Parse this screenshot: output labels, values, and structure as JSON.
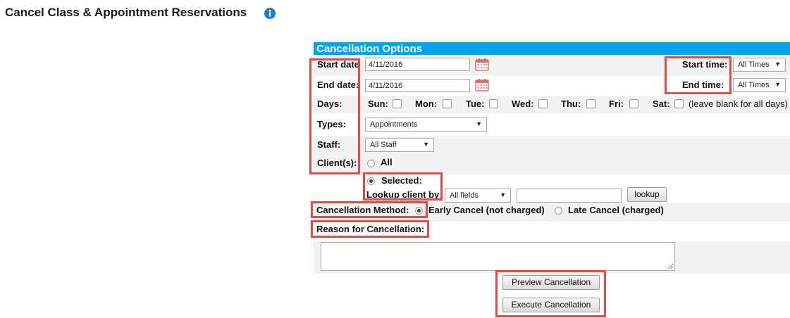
{
  "page": {
    "title": "Cancel Class & Appointment Reservations"
  },
  "panel": {
    "header": "Cancellation Options"
  },
  "labels": {
    "start_date": "Start date",
    "end_date": "End date:",
    "days": "Days:",
    "types": "Types:",
    "staff": "Staff:",
    "clients": "Client(s):",
    "start_time": "Start time:",
    "end_time": "End time:",
    "cancellation_method": "Cancellation Method:",
    "reason": "Reason for Cancellation:",
    "lookup_client_by": "Lookup client by"
  },
  "fields": {
    "start_date": "4/11/2016",
    "end_date": "4/11/2016",
    "start_time": "All Times",
    "end_time": "All Times",
    "types": "Appointments",
    "staff": "All Staff",
    "lookup_by": "All fields",
    "lookup_value": "",
    "reason": ""
  },
  "days": [
    {
      "label": "Sun:",
      "checked": false
    },
    {
      "label": "Mon:",
      "checked": false
    },
    {
      "label": "Tue:",
      "checked": false
    },
    {
      "label": "Wed:",
      "checked": false
    },
    {
      "label": "Thu:",
      "checked": false
    },
    {
      "label": "Fri:",
      "checked": false
    },
    {
      "label": "Sat:",
      "checked": false
    }
  ],
  "days_hint": "(leave blank for all days)",
  "clients": {
    "all_label": "All",
    "selected_label": "Selected:",
    "selected": "selected"
  },
  "cancellation_method": {
    "early_label": "Early Cancel (not charged)",
    "late_label": "Late Cancel (charged)",
    "selected": "early"
  },
  "buttons": {
    "lookup": "lookup",
    "preview": "Preview Cancellation",
    "execute": "Execute Cancellation"
  },
  "icons": {
    "info": "info-icon",
    "calendar": "calendar-icon"
  },
  "colors": {
    "header_bg": "#00a6e5",
    "callout": "#e04c47",
    "info_icon": "#1f7bc6",
    "row_bg": "#f2f2f2"
  }
}
